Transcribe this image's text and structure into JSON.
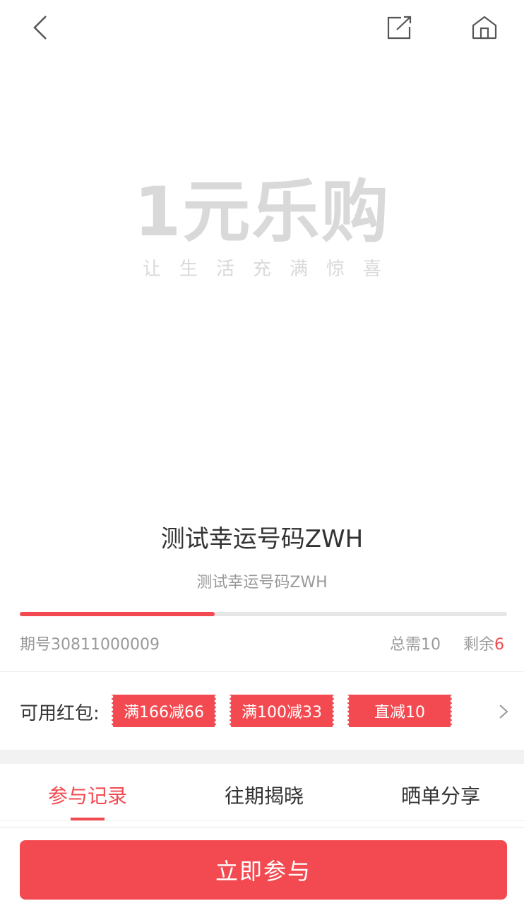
{
  "header": {
    "back_icon": "chevron-left-icon",
    "share_icon": "share-icon",
    "home_icon": "home-icon"
  },
  "logo": {
    "main": "1元乐购",
    "tagline": "让生活充满惊喜"
  },
  "product": {
    "title": "测试幸运号码ZWH",
    "subtitle": "测试幸运号码ZWH",
    "progress_fraction": 0.4
  },
  "stats": {
    "period": "期号30811000009",
    "total": "总需10",
    "remain_label": "剩余",
    "remain_value": "6"
  },
  "coupons": {
    "label": "可用红包:",
    "items": [
      "满166减66",
      "满100减33",
      "直减10"
    ]
  },
  "tabs": [
    "参与记录",
    "往期揭晓",
    "晒单分享"
  ],
  "footer": {
    "cta_label": "立即参与"
  },
  "colors": {
    "accent": "#f24a50",
    "muted": "#999999",
    "logo": "#d9d9d9"
  }
}
